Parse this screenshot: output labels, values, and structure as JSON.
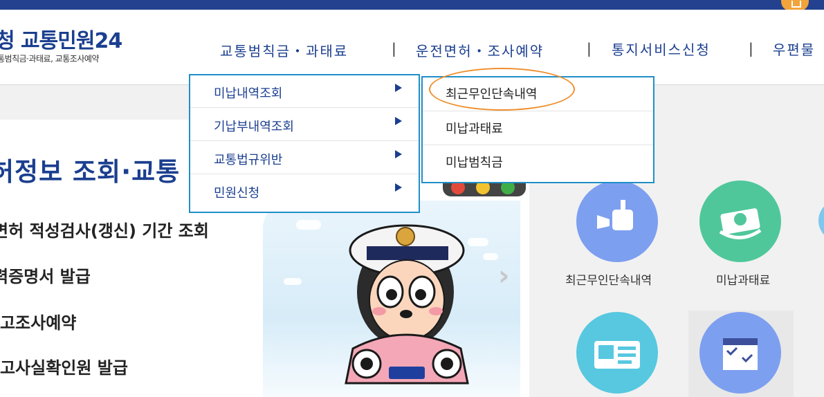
{
  "header": {
    "logo_title": "청 교통민원24",
    "logo_sub": "통범칙금·과태료, 교통조사예약"
  },
  "gnb": {
    "items": [
      {
        "label": "교통범칙금・과태료"
      },
      {
        "label": "운전면허・조사예약"
      },
      {
        "label": "통지서비스신청"
      },
      {
        "label": "우편물"
      }
    ],
    "separator": "|"
  },
  "menu": {
    "items": [
      {
        "label": "미납내역조회"
      },
      {
        "label": "기납부내역조회"
      },
      {
        "label": "교통법규위반"
      },
      {
        "label": "민원신청"
      }
    ]
  },
  "submenu": {
    "items": [
      {
        "label": "최근무인단속내역"
      },
      {
        "label": "미납과태료"
      },
      {
        "label": "미납범칙금"
      }
    ]
  },
  "hero": {
    "title": "허정보 조회·교통",
    "items": [
      "면허 적성검사(갱신) 기간 조회",
      "력증명서 발급",
      "-고조사예약",
      "-고사실확인원 발급"
    ],
    "next_icon": "chevron-right-icon"
  },
  "quick": {
    "items": [
      {
        "label": "최근무인단속내역",
        "icon": "camera-icon",
        "color": "#7d9ff0"
      },
      {
        "label": "미납과태료",
        "icon": "money-icon",
        "color": "#4fc79a"
      },
      {
        "label": "",
        "icon": "id-card-icon",
        "color": "#57c8e0"
      },
      {
        "label": "",
        "icon": "calendar-icon",
        "color": "#7d9ff0"
      }
    ]
  },
  "colors": {
    "brand": "#1b3f8f",
    "menu_border": "#1f8fc8",
    "highlight": "#ee8f2d"
  }
}
